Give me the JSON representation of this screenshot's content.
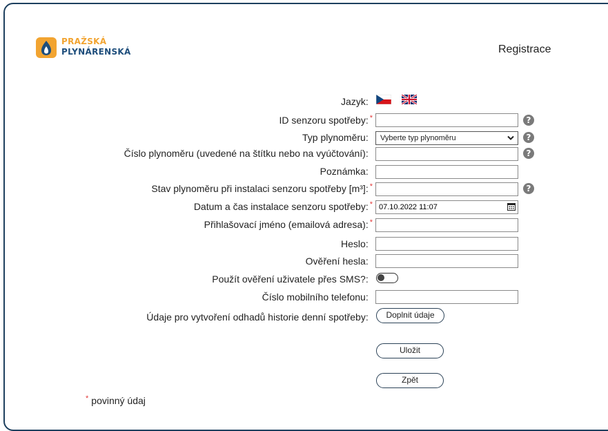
{
  "brand": {
    "line1": "PRAŽSKÁ",
    "line2": "PLYNÁRENSKÁ"
  },
  "page": {
    "title": "Registrace"
  },
  "form": {
    "language_label": "Jazyk:",
    "languages": [
      "cs-flag",
      "en-flag"
    ],
    "fields": [
      {
        "label": "ID senzoru spotřeby:",
        "value": ""
      },
      {
        "label": "Typ plynoměru:",
        "value": "Vyberte typ plynoměru"
      },
      {
        "label": "Číslo plynoměru (uvedené na štítku nebo na vyúčtování):",
        "value": ""
      },
      {
        "label": "Poznámka:",
        "value": ""
      },
      {
        "label": "Stav plynoměru při instalaci senzoru spotřeby [m³]:",
        "value": ""
      },
      {
        "label": "Datum a čas instalace senzoru spotřeby:",
        "value": "07.10.2022 11:07"
      },
      {
        "label": "Přihlašovací jméno (emailová adresa):",
        "value": ""
      },
      {
        "label": "Heslo:",
        "value": ""
      },
      {
        "label": "Ověření hesla:",
        "value": ""
      },
      {
        "label": "Použít ověření uživatele přes SMS?:",
        "value": ""
      },
      {
        "label": "Číslo mobilního telefonu:",
        "value": ""
      },
      {
        "label": "Údaje pro vytvoření odhadů historie denní spotřeby:",
        "value": ""
      }
    ],
    "required_mark": "*",
    "help_glyph": "?",
    "sms_enabled": false,
    "fill_button": "Doplnit údaje",
    "save_button": "Uložit",
    "back_button": "Zpět",
    "legend_text": "povinný údaj"
  },
  "colors": {
    "accent": "#f2a431",
    "brand_blue": "#1e4e7c",
    "required": "#e23b3b",
    "border": "#1d3f5e"
  }
}
